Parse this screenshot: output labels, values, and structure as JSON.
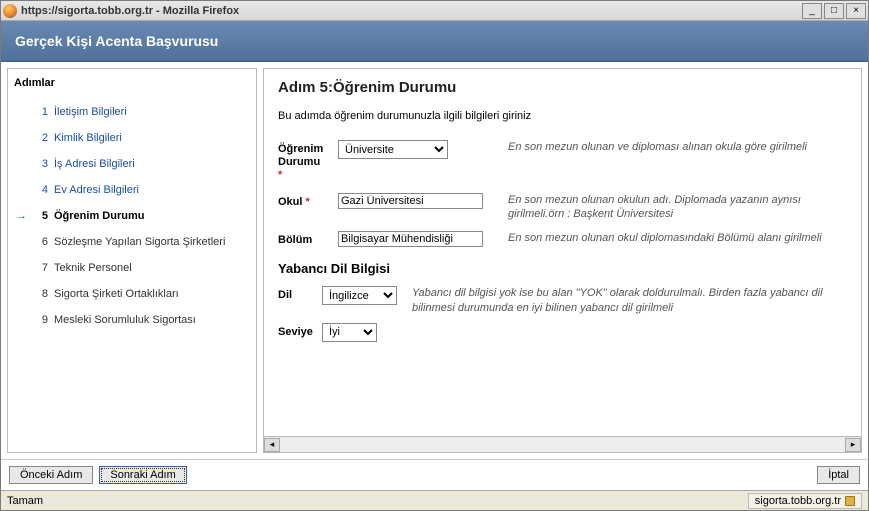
{
  "window": {
    "title": "https://sigorta.tobb.org.tr - Mozilla Firefox",
    "minimize": "_",
    "maximize": "□",
    "close": "×"
  },
  "header": {
    "title": "Gerçek Kişi Acenta Başvurusu"
  },
  "sidebar": {
    "heading": "Adımlar",
    "steps": [
      {
        "num": "1",
        "label": "İletişim Bilgileri",
        "link": true,
        "current": false
      },
      {
        "num": "2",
        "label": "Kimlik Bilgileri",
        "link": true,
        "current": false
      },
      {
        "num": "3",
        "label": "İş Adresi Bilgileri",
        "link": true,
        "current": false
      },
      {
        "num": "4",
        "label": "Ev Adresi Bilgileri",
        "link": true,
        "current": false
      },
      {
        "num": "5",
        "label": "Öğrenim Durumu",
        "link": false,
        "current": true
      },
      {
        "num": "6",
        "label": "Sözleşme Yapılan Sigorta Şirketleri",
        "link": false,
        "current": false
      },
      {
        "num": "7",
        "label": "Teknik Personel",
        "link": false,
        "current": false
      },
      {
        "num": "8",
        "label": "Sigorta Şirketi Ortaklıkları",
        "link": false,
        "current": false
      },
      {
        "num": "9",
        "label": "Mesleki Sorumluluk Sigortası",
        "link": false,
        "current": false
      }
    ]
  },
  "main": {
    "heading": "Adım 5:Öğrenim Durumu",
    "instruction": "Bu adımda öğrenim durumunuzla ilgili bilgileri giriniz",
    "fields": {
      "ogrenim_label": "Öğrenim Durumu",
      "ogrenim_value": "Üniversite",
      "ogrenim_hint": "En son mezun olunan ve diploması alınan okula göre girilmeli",
      "okul_label": "Okul",
      "okul_value": "Gazi Üniversitesi",
      "okul_hint": "En son mezun olunan okulun adı. Diplomada yazanın aynısı girilmeli.örn : Başkent Üniversitesi",
      "bolum_label": "Bölüm",
      "bolum_value": "Bilgisayar Mühendisliği",
      "bolum_hint": "En son mezun olunan okul diplomasındaki Bölümü alanı girilmeli"
    },
    "lang_section": "Yabancı Dil Bilgisi",
    "lang": {
      "dil_label": "Dil",
      "dil_value": "İngilizce",
      "dil_hint": "Yabancı dil bilgisi yok ise bu alan \"YOK\" olarak doldurulmalı. Birden fazla yabancı dil bilinmesi durumunda en iyi bilinen yabancı dil girilmeli",
      "seviye_label": "Seviye",
      "seviye_value": "İyi"
    }
  },
  "buttons": {
    "prev": "Önceki Adım",
    "next": "Sonraki Adım",
    "cancel": "İptal"
  },
  "status": {
    "left": "Tamam",
    "right": "sigorta.tobb.org.tr"
  }
}
